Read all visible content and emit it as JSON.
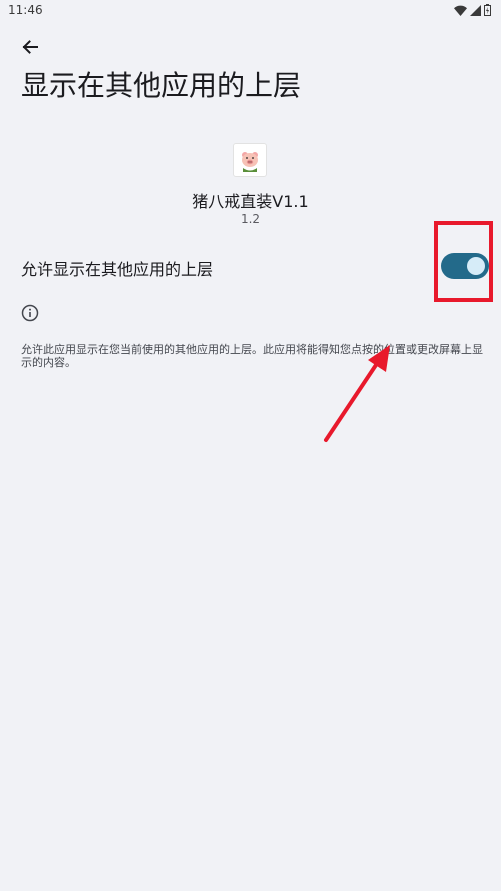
{
  "status_bar": {
    "time": "11:46",
    "icons": [
      "wifi-icon",
      "signal-icon",
      "battery-icon"
    ]
  },
  "header": {
    "back_icon": "arrow-left-icon",
    "title": "显示在其他应用的上层"
  },
  "app": {
    "name": "猪八戒直装V1.1",
    "version": "1.2",
    "icon": "pig-icon"
  },
  "permission": {
    "label": "允许显示在其他应用的上层",
    "enabled": true
  },
  "info": {
    "icon": "info-icon",
    "description": "允许此应用显示在您当前使用的其他应用的上层。此应用将能得知您点按的位置或更改屏幕上显示的内容。"
  },
  "colors": {
    "background": "#f1f2f6",
    "toggle_track": "#236a8a",
    "toggle_thumb": "#d6ecf8",
    "annotation": "#e8192c"
  }
}
